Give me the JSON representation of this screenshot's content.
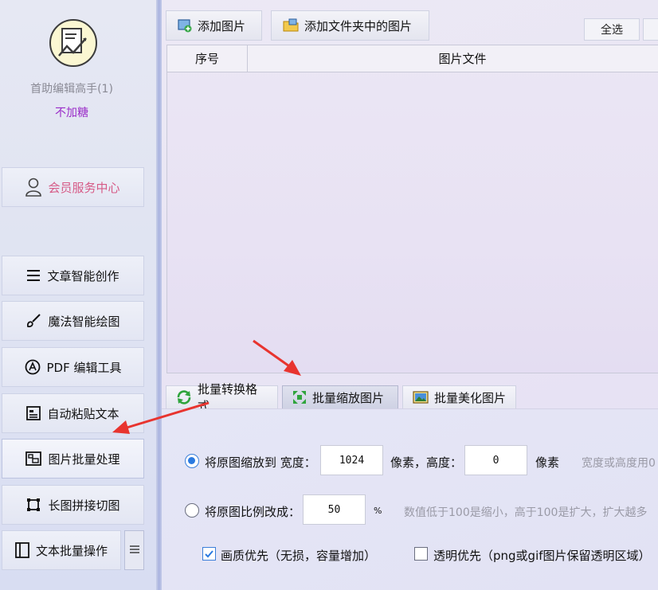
{
  "sidebar": {
    "user_name": "首助编辑高手(1)",
    "user_tag": "不加糖",
    "member_center": "会员服务中心",
    "items": [
      {
        "label": "文章智能创作",
        "icon": "list-icon"
      },
      {
        "label": "魔法智能绘图",
        "icon": "brush-icon"
      },
      {
        "label": "PDF 编辑工具",
        "icon": "pdf-icon"
      },
      {
        "label": "自动粘贴文本",
        "icon": "paste-icon"
      },
      {
        "label": "图片批量处理",
        "icon": "image-batch-icon"
      },
      {
        "label": "长图拼接切图",
        "icon": "crop-icon"
      },
      {
        "label": "文本批量操作",
        "icon": "text-batch-icon"
      }
    ]
  },
  "toolbar": {
    "add_image": "添加图片",
    "add_folder_images": "添加文件夹中的图片",
    "select_all": "全选"
  },
  "table": {
    "col_index": "序号",
    "col_file": "图片文件"
  },
  "tabs": [
    {
      "label": "批量转换格式",
      "active": false
    },
    {
      "label": "批量缩放图片",
      "active": true
    },
    {
      "label": "批量美化图片",
      "active": false
    }
  ],
  "settings": {
    "resize_label": "将原图缩放到 宽度：",
    "width_value": "1024",
    "width_unit": "像素，高度：",
    "height_value": "0",
    "height_unit": "像素",
    "resize_hint": "宽度或高度用0",
    "scale_label": "将原图比例改成：",
    "scale_value": "50",
    "scale_unit": "%",
    "scale_hint": "数值低于100是缩小，高于100是扩大，扩大越多",
    "quality_label": "画质优先（无损，容量增加）",
    "transparent_label": "透明优先（png或gif图片保留透明区域）"
  },
  "colors": {
    "accent": "#2b7ae0",
    "member": "#d65a86",
    "user_tag": "#9a2cc8",
    "arrow": "#e8342f"
  }
}
